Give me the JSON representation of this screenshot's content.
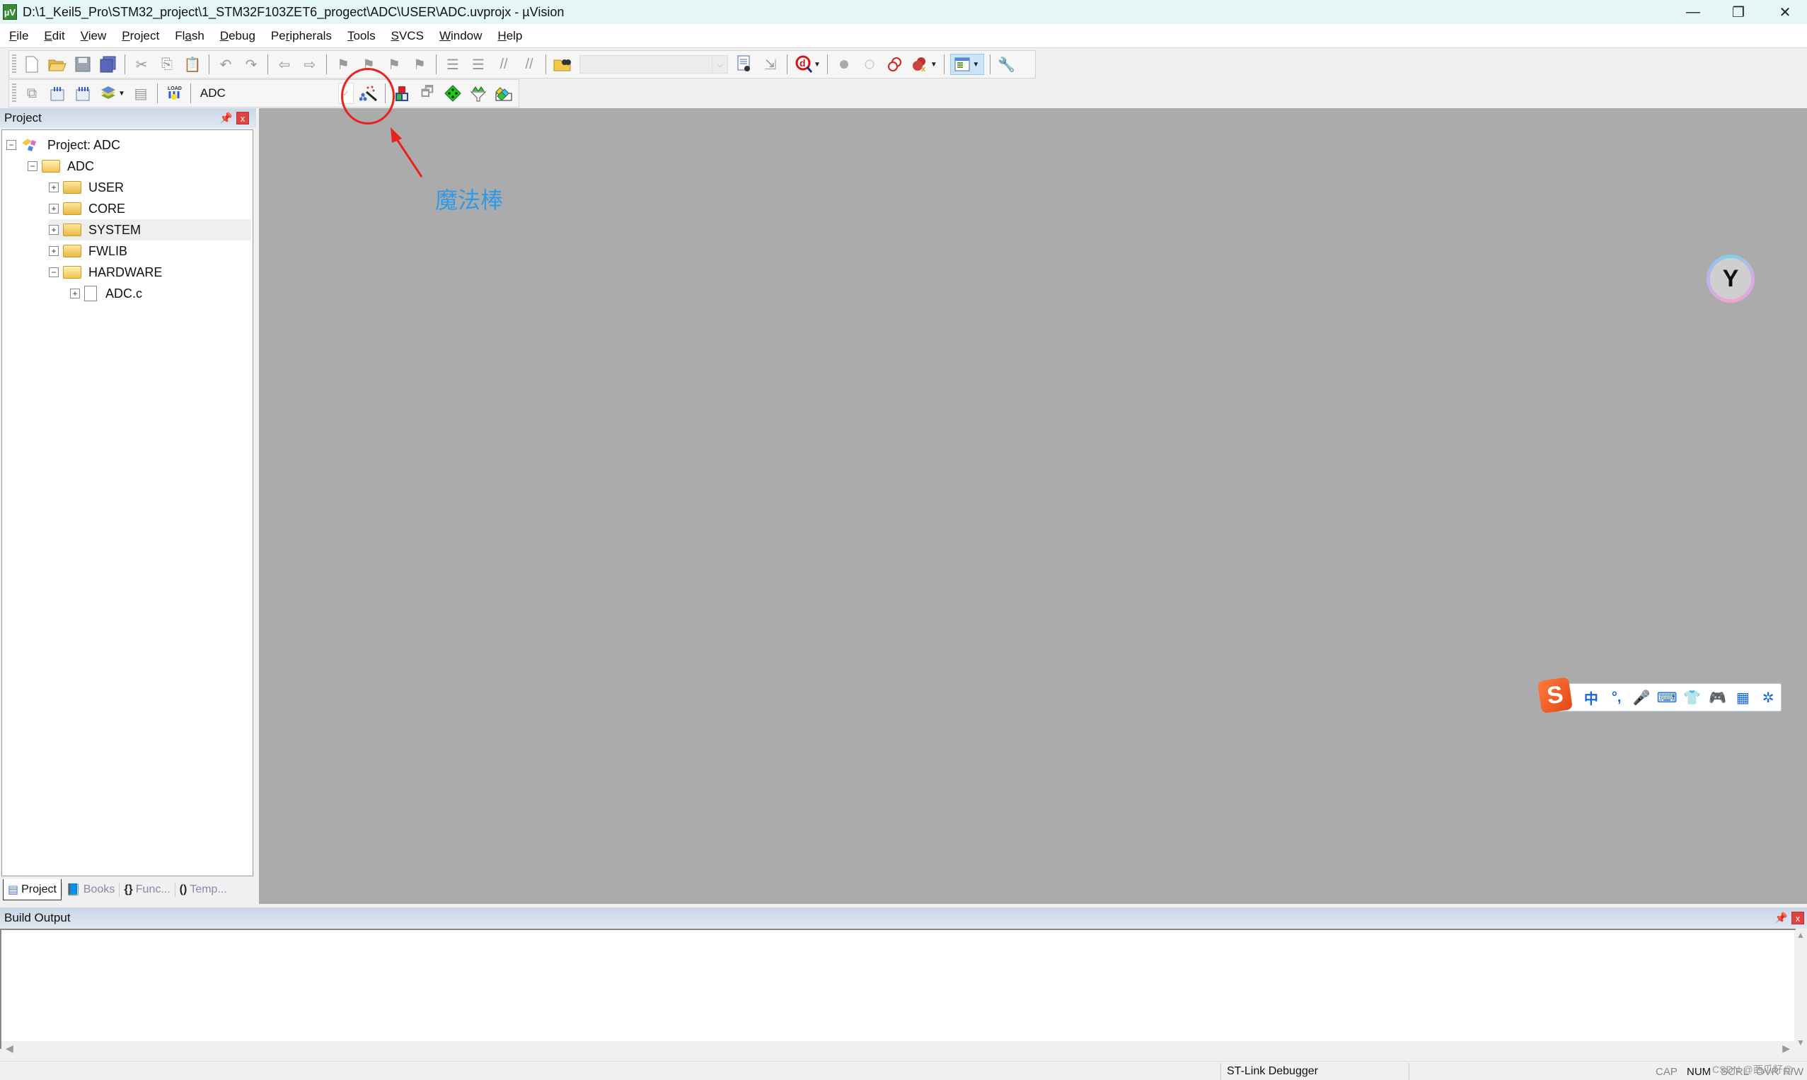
{
  "window": {
    "title": "D:\\1_Keil5_Pro\\STM32_project\\1_STM32F103ZET6_progect\\ADC\\USER\\ADC.uvprojx - µVision",
    "app_icon": "µV",
    "controls": {
      "minimize": "—",
      "restore": "❐",
      "close": "✕"
    }
  },
  "menu": [
    {
      "label": "File",
      "accel": "F",
      "rest": "ile"
    },
    {
      "label": "Edit",
      "accel": "E",
      "rest": "dit"
    },
    {
      "label": "View",
      "accel": "V",
      "rest": "iew"
    },
    {
      "label": "Project",
      "accel": "P",
      "rest": "roject"
    },
    {
      "label": "Flash",
      "pre": "Fl",
      "accel": "a",
      "rest": "sh"
    },
    {
      "label": "Debug",
      "accel": "D",
      "rest": "ebug"
    },
    {
      "label": "Peripherals",
      "pre": "Pe",
      "accel": "r",
      "rest": "ipherals"
    },
    {
      "label": "Tools",
      "accel": "T",
      "rest": "ools"
    },
    {
      "label": "SVCS",
      "accel": "S",
      "rest": "VCS"
    },
    {
      "label": "Window",
      "accel": "W",
      "rest": "indow"
    },
    {
      "label": "Help",
      "accel": "H",
      "rest": "elp"
    }
  ],
  "toolbar1": {
    "icons": [
      "new-file",
      "open-file",
      "save",
      "save-all",
      "cut",
      "copy",
      "paste",
      "undo",
      "redo",
      "navigate-back",
      "navigate-forward",
      "bookmark-insert",
      "bookmark-prev",
      "bookmark-next",
      "bookmark-clear",
      "indent",
      "unindent",
      "comment",
      "uncomment",
      "find-in-files",
      "find",
      "incremental-find",
      "debug-session",
      "breakpoint-insert",
      "breakpoint-enable",
      "breakpoint-disable",
      "breakpoint-kill-all",
      "window-layout",
      "configure"
    ],
    "find_combo_value": ""
  },
  "toolbar2": {
    "icons": [
      "translate",
      "build",
      "rebuild",
      "batch-build",
      "stop-build",
      "download",
      "target-options",
      "manage-components",
      "select-packs",
      "manage-run-env",
      "pack-installer"
    ],
    "target_name": "ADC"
  },
  "project_panel": {
    "title": "Project",
    "pin": "🖈",
    "close": "x",
    "tree": [
      {
        "label": "Project: ADC",
        "level": 0,
        "expanded": true,
        "type": "project"
      },
      {
        "label": "ADC",
        "level": 1,
        "expanded": true,
        "type": "target"
      },
      {
        "label": "USER",
        "level": 2,
        "expanded": false,
        "type": "folder"
      },
      {
        "label": "CORE",
        "level": 2,
        "expanded": false,
        "type": "folder"
      },
      {
        "label": "SYSTEM",
        "level": 2,
        "expanded": false,
        "type": "folder",
        "selected": true
      },
      {
        "label": "FWLIB",
        "level": 2,
        "expanded": false,
        "type": "folder"
      },
      {
        "label": "HARDWARE",
        "level": 2,
        "expanded": true,
        "type": "folder"
      },
      {
        "label": "ADC.c",
        "level": 3,
        "expanded": false,
        "type": "file"
      }
    ],
    "tabs": [
      {
        "label": "Project",
        "icon": "project-tab-icon",
        "active": true
      },
      {
        "label": "Books",
        "icon": "books-icon",
        "active": false
      },
      {
        "label": "Func...",
        "icon": "functions-icon",
        "active": false
      },
      {
        "label": "Temp...",
        "icon": "templates-icon",
        "active": false
      }
    ]
  },
  "annotation": {
    "label": "魔法棒",
    "color": "#2d9be8",
    "circle_color": "#e8231c"
  },
  "build_output": {
    "title": "Build Output",
    "content": ""
  },
  "statusbar": {
    "debugger": "ST-Link Debugger",
    "keys": [
      "CAP",
      "NUM",
      "SCRL",
      "OVR",
      "R/W"
    ],
    "active_keys": [
      "NUM"
    ]
  },
  "ime_toolbar": {
    "logo": "S",
    "items": [
      "中",
      "°,",
      "🎤",
      "⌨",
      "👕",
      "🎮",
      "▦",
      "✲"
    ]
  },
  "floating_button": {
    "glyph": "Y"
  },
  "watermark": "CSDN @西瓜籽@"
}
